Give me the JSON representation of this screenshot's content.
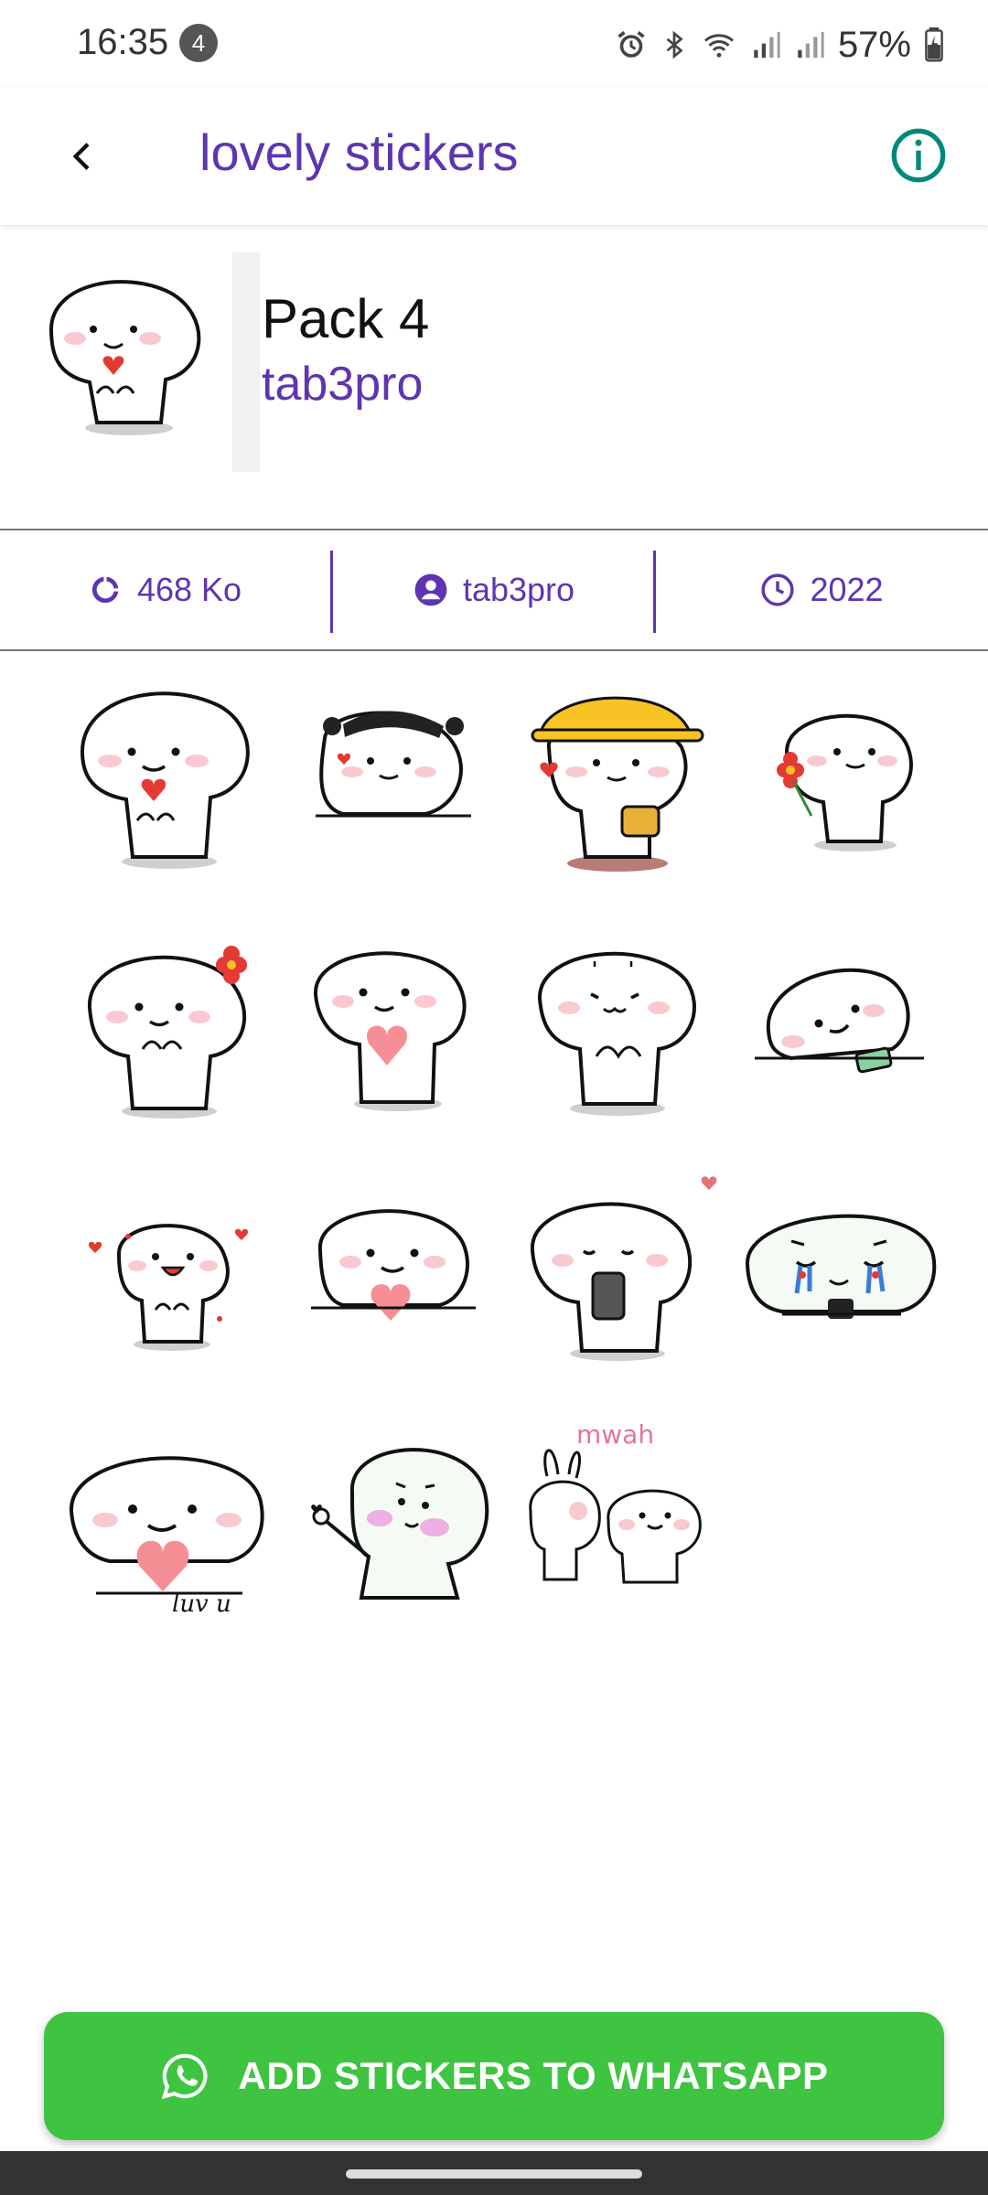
{
  "status_bar": {
    "time": "16:35",
    "notification_count": "4",
    "battery": "57%",
    "icons": [
      "alarm-icon",
      "bluetooth-icon",
      "wifi-icon",
      "signal-icon",
      "signal-icon",
      "battery-icon"
    ]
  },
  "app_bar": {
    "title": "lovely stickers",
    "back_icon": "chevron-left-icon",
    "info_icon": "info-icon"
  },
  "pack": {
    "name": "Pack 4",
    "publisher": "tab3pro"
  },
  "info_bar": {
    "size": "468 Ko",
    "author": "tab3pro",
    "year": "2022"
  },
  "stickers": [
    {
      "name": "sticker-heart-hands"
    },
    {
      "name": "sticker-pigtails"
    },
    {
      "name": "sticker-yellow-hat"
    },
    {
      "name": "sticker-flower"
    },
    {
      "name": "sticker-flower-hair"
    },
    {
      "name": "sticker-heart"
    },
    {
      "name": "sticker-shy"
    },
    {
      "name": "sticker-lying-phone"
    },
    {
      "name": "sticker-happy"
    },
    {
      "name": "sticker-heart-small"
    },
    {
      "name": "sticker-phone"
    },
    {
      "name": "sticker-crying"
    },
    {
      "name": "sticker-luv-u",
      "text": "luv u"
    },
    {
      "name": "sticker-finger-heart"
    },
    {
      "name": "sticker-mwah",
      "text": "mwah"
    }
  ],
  "add_button": {
    "label": "ADD STICKERS TO WHATSAPP",
    "icon": "whatsapp-icon"
  },
  "colors": {
    "accent": "#5e35b1",
    "button": "#3ec440",
    "info_icon": "#00897b"
  }
}
